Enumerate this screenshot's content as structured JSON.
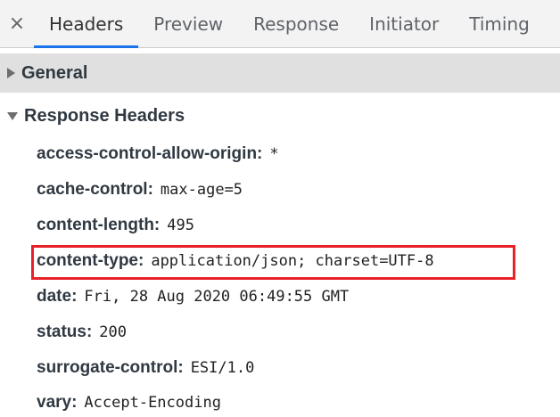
{
  "tabs": {
    "close_glyph": "×",
    "items": [
      {
        "label": "Headers",
        "active": true
      },
      {
        "label": "Preview",
        "active": false
      },
      {
        "label": "Response",
        "active": false
      },
      {
        "label": "Initiator",
        "active": false
      },
      {
        "label": "Timing",
        "active": false
      }
    ]
  },
  "sections": {
    "general": {
      "title": "General",
      "expanded": false
    },
    "response_headers": {
      "title": "Response Headers",
      "expanded": true
    }
  },
  "response_headers": [
    {
      "name": "access-control-allow-origin:",
      "value": "*"
    },
    {
      "name": "cache-control:",
      "value": "max-age=5"
    },
    {
      "name": "content-length:",
      "value": "495"
    },
    {
      "name": "content-type:",
      "value": "application/json; charset=UTF-8"
    },
    {
      "name": "date:",
      "value": "Fri, 28 Aug 2020 06:49:55 GMT"
    },
    {
      "name": "status:",
      "value": "200"
    },
    {
      "name": "surrogate-control:",
      "value": "ESI/1.0"
    },
    {
      "name": "vary:",
      "value": "Accept-Encoding"
    }
  ],
  "colors": {
    "active_tab_underline": "#1a73e8",
    "highlight_border": "#e8202a",
    "section_bg": "#e0e0e0"
  }
}
